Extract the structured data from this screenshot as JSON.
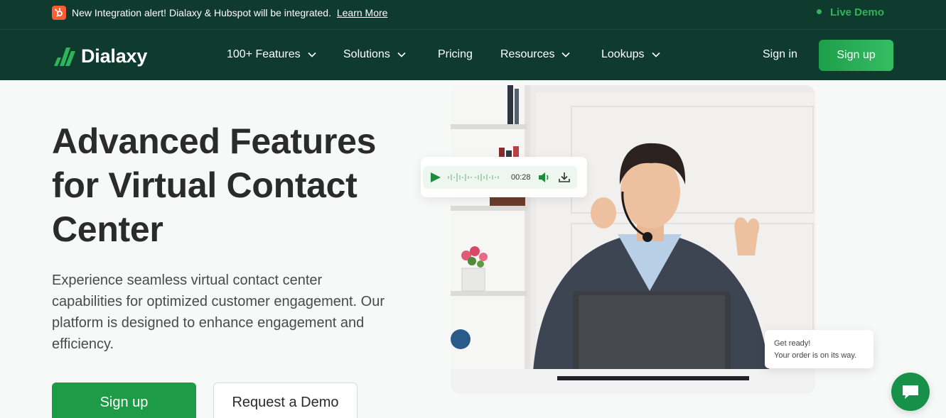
{
  "announcement": {
    "message": "New Integration alert! Dialaxy & Hubspot will be integrated.",
    "link_label": "Learn More",
    "live_demo_label": "Live Demo"
  },
  "nav": {
    "brand": "Dialaxy",
    "items": [
      {
        "label": "100+ Features",
        "has_dropdown": true
      },
      {
        "label": "Solutions",
        "has_dropdown": true
      },
      {
        "label": "Pricing",
        "has_dropdown": false
      },
      {
        "label": "Resources",
        "has_dropdown": true
      },
      {
        "label": "Lookups",
        "has_dropdown": true
      }
    ],
    "signin_label": "Sign in",
    "signup_label": "Sign up"
  },
  "hero": {
    "title": "Advanced Features for Virtual Contact Center",
    "description": "Experience seamless virtual contact center capabilities for optimized customer engagement. Our platform is designed to enhance engagement and efficiency.",
    "primary_cta": "Sign up",
    "secondary_cta": "Request a Demo"
  },
  "audio_player": {
    "time": "00:28",
    "icons": [
      "play-icon",
      "waveform-icon",
      "volume-icon",
      "download-icon"
    ]
  },
  "toast": {
    "line1": "Get ready!",
    "line2": "Your order is on its way."
  },
  "chat": {
    "icon": "chat-bubble-icon"
  },
  "colors": {
    "nav_bg": "#0f3a2e",
    "brand_green": "#1e9b47",
    "accent_green": "#2fb45a",
    "page_bg": "#f7f8f8",
    "hubspot_orange": "#ff5c35"
  }
}
